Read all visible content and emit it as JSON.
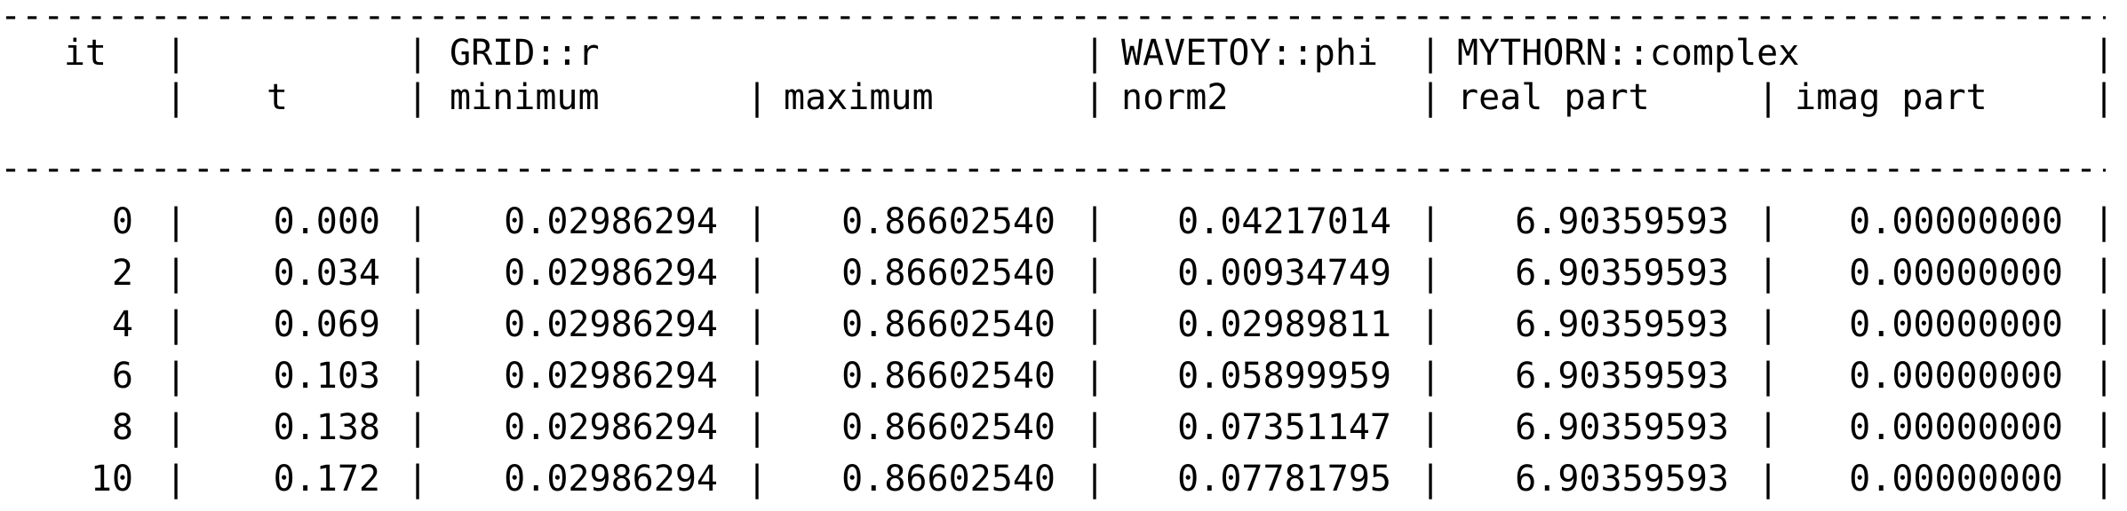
{
  "rule_text": "--------------------------------------------------------------------------------------------------------------------------------------------------",
  "header": {
    "row1": {
      "it": "it",
      "t": "",
      "grid": "GRID::r",
      "wavetoy": "WAVETOY::phi",
      "mythorn": "MYTHORN::complex"
    },
    "row2": {
      "it": "",
      "t": "t",
      "min": "minimum",
      "max": "maximum",
      "norm2": "norm2",
      "real": "real part",
      "imag": "imag part"
    }
  },
  "rows": [
    {
      "it": "0",
      "t": "0.000",
      "min": "0.02986294",
      "max": "0.86602540",
      "norm2": "0.04217014",
      "real": "6.90359593",
      "imag": "0.00000000"
    },
    {
      "it": "2",
      "t": "0.034",
      "min": "0.02986294",
      "max": "0.86602540",
      "norm2": "0.00934749",
      "real": "6.90359593",
      "imag": "0.00000000"
    },
    {
      "it": "4",
      "t": "0.069",
      "min": "0.02986294",
      "max": "0.86602540",
      "norm2": "0.02989811",
      "real": "6.90359593",
      "imag": "0.00000000"
    },
    {
      "it": "6",
      "t": "0.103",
      "min": "0.02986294",
      "max": "0.86602540",
      "norm2": "0.05899959",
      "real": "6.90359593",
      "imag": "0.00000000"
    },
    {
      "it": "8",
      "t": "0.138",
      "min": "0.02986294",
      "max": "0.86602540",
      "norm2": "0.07351147",
      "real": "6.90359593",
      "imag": "0.00000000"
    },
    {
      "it": "10",
      "t": "0.172",
      "min": "0.02986294",
      "max": "0.86602540",
      "norm2": "0.07781795",
      "real": "6.90359593",
      "imag": "0.00000000"
    }
  ]
}
